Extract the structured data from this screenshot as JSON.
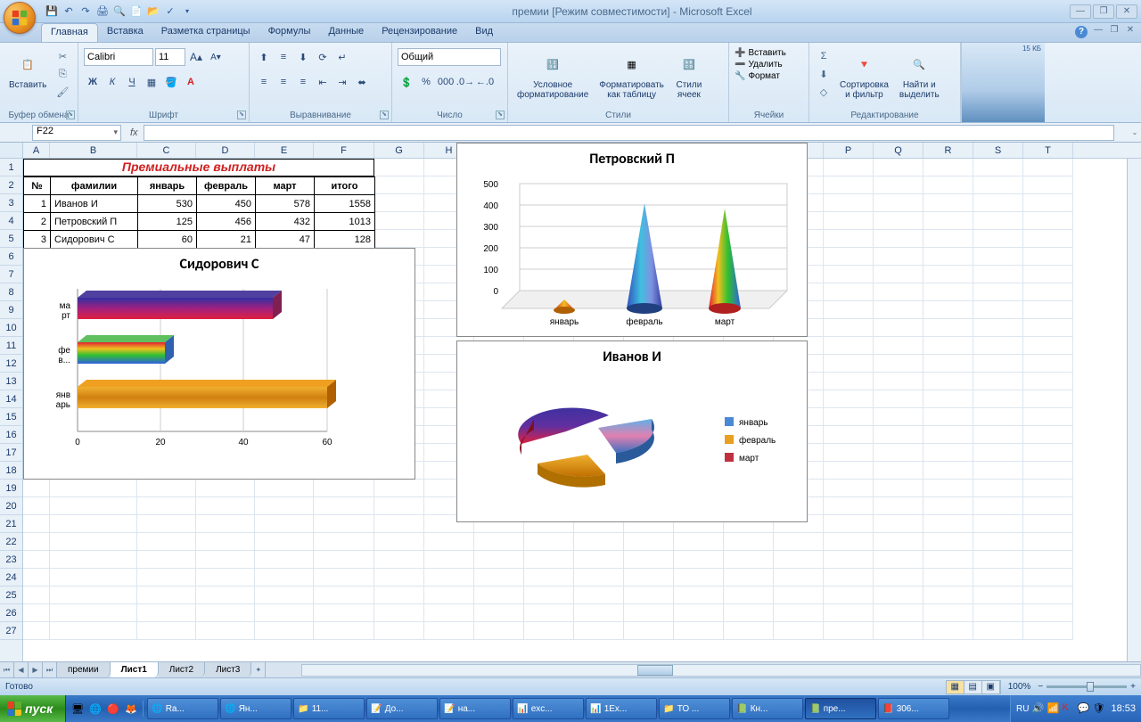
{
  "title": "премии  [Режим совместимости] - Microsoft Excel",
  "qat_size_label": "15 КБ",
  "tabs": [
    "Главная",
    "Вставка",
    "Разметка страницы",
    "Формулы",
    "Данные",
    "Рецензирование",
    "Вид"
  ],
  "active_tab": 0,
  "groups": {
    "clipboard": "Буфер обмена",
    "font": "Шрифт",
    "align": "Выравнивание",
    "number": "Число",
    "styles": "Стили",
    "cells": "Ячейки",
    "editing": "Редактирование"
  },
  "paste_label": "Вставить",
  "font_name": "Calibri",
  "font_size": "11",
  "number_format": "Общий",
  "styles_btns": {
    "cond": "Условное\nформатирование",
    "table": "Форматировать\nкак таблицу",
    "cell": "Стили\nячеек"
  },
  "cells_btns": {
    "insert": "Вставить",
    "delete": "Удалить",
    "format": "Формат"
  },
  "editing_btns": {
    "sort": "Сортировка\nи фильтр",
    "find": "Найти и\nвыделить"
  },
  "name_box": "F22",
  "table": {
    "title": "Премиальные выплаты",
    "headers": [
      "№",
      "фамилии",
      "январь",
      "февраль",
      "март",
      "итого"
    ],
    "rows": [
      [
        "1",
        "Иванов И",
        "530",
        "450",
        "578",
        "1558"
      ],
      [
        "2",
        "Петровский П",
        "125",
        "456",
        "432",
        "1013"
      ],
      [
        "3",
        "Сидорович С",
        "60",
        "21",
        "47",
        "128"
      ]
    ]
  },
  "chart_data": [
    {
      "type": "bar",
      "orientation": "horizontal-3d",
      "title": "Сидорович С",
      "categories": [
        "март",
        "февраль",
        "январь"
      ],
      "values": [
        47,
        21,
        60
      ],
      "xlim": [
        0,
        60
      ],
      "xticks": [
        0,
        20,
        40,
        60
      ]
    },
    {
      "type": "cone-3d",
      "title": "Петровский П",
      "categories": [
        "январь",
        "февраль",
        "март"
      ],
      "values": [
        125,
        456,
        432
      ],
      "ylim": [
        0,
        500
      ],
      "yticks": [
        0,
        100,
        200,
        300,
        400,
        500
      ]
    },
    {
      "type": "pie-3d-exploded",
      "title": "Иванов И",
      "categories": [
        "январь",
        "февраль",
        "март"
      ],
      "values": [
        530,
        450,
        578
      ],
      "colors": [
        "#4a8ad4",
        "#e8a020",
        "#c03040"
      ]
    }
  ],
  "sheet_tabs": [
    "премии",
    "Лист1",
    "Лист2",
    "Лист3"
  ],
  "active_sheet": 1,
  "status": "Готово",
  "zoom": "100%",
  "start_label": "пуск",
  "task_apps": [
    "Ra...",
    "Ян...",
    "11...",
    "До...",
    "на...",
    "exc...",
    "1Ex...",
    "ТО ...",
    "Кн...",
    "пре...",
    "306..."
  ],
  "active_task": 9,
  "tray": {
    "lang": "RU"
  },
  "clock": "18:53",
  "col_widths": {
    "A": 30,
    "B": 98,
    "C": 66,
    "D": 66,
    "E": 66,
    "F": 68,
    "default": 56
  },
  "columns": [
    "A",
    "B",
    "C",
    "D",
    "E",
    "F",
    "G",
    "H",
    "I",
    "J",
    "K",
    "L",
    "M",
    "N",
    "O",
    "P",
    "Q",
    "R",
    "S",
    "T"
  ]
}
